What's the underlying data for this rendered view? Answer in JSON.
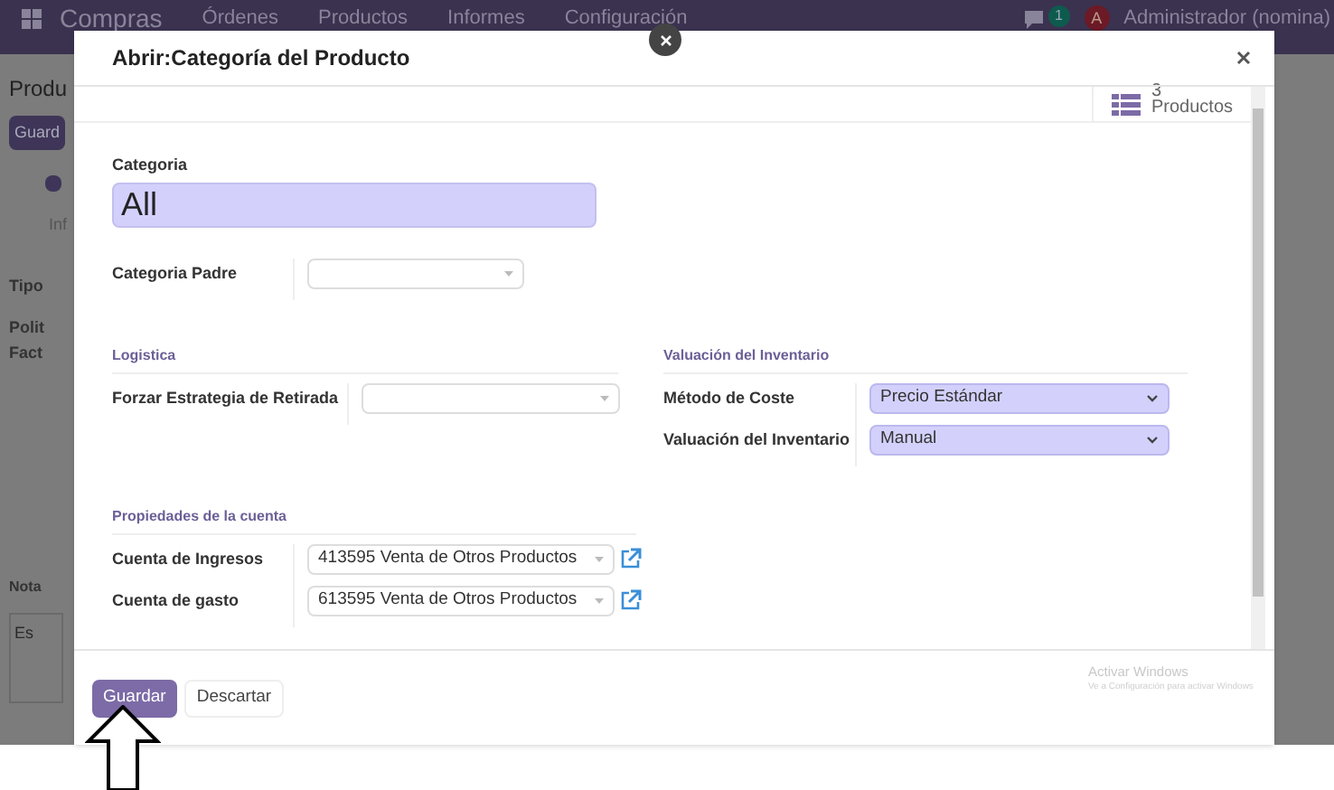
{
  "top_bar": {
    "app": "Compras",
    "menu": [
      "Órdenes",
      "Productos",
      "Informes",
      "Configuración"
    ],
    "badge": "1",
    "avatar": "A",
    "user": "Administrador (nomina)"
  },
  "background": {
    "title": "Produ",
    "button": "Guard",
    "checkbox_checked": true,
    "tab": "Inf",
    "labels": [
      "Tipo",
      "Polit",
      "Fact"
    ],
    "notes_label": "Nota",
    "notes_placeholder": "Es"
  },
  "dialog": {
    "title": "Abrir:Categoría del Producto",
    "smart_button": {
      "count": "3",
      "label": "Productos"
    },
    "name": {
      "label": "Categoria",
      "value": "All"
    },
    "parent": {
      "label": "Categoria Padre"
    },
    "groups": [
      {
        "title": "Logistica",
        "fields": [
          {
            "label": "Forzar Estrategia de Retirada",
            "kind": "many2one"
          }
        ]
      },
      {
        "title": "Valuación del Inventario",
        "fields": [
          {
            "label": "Método de Coste",
            "kind": "select",
            "value": "Precio Estándar"
          },
          {
            "label": "Valuación del Inventario",
            "kind": "select",
            "value": "Manual"
          }
        ]
      },
      {
        "title": "Propiedades de la cuenta",
        "fields": [
          {
            "label": "Cuenta de Ingresos",
            "kind": "many2one",
            "value": "413595 Venta de Otros Productos",
            "external_link": true
          },
          {
            "label": "Cuenta de gasto",
            "kind": "many2one",
            "value": "613595 Venta de Otros Productos",
            "external_link": true
          }
        ]
      }
    ],
    "buttons": [
      {
        "label": "Guardar",
        "primary": true
      },
      {
        "label": "Descartar",
        "primary": false
      }
    ]
  },
  "os_notice": {
    "title": "Activar Windows",
    "text": "Ve a Configuración para activar Windows"
  }
}
